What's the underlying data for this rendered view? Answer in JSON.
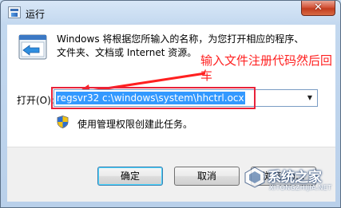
{
  "window": {
    "title": "运行",
    "close_glyph": "✕"
  },
  "description": {
    "line1": "Windows 将根据您所输入的名称，为您打开相应的程序、",
    "line2": "文件夹、文档或 Internet 资源。"
  },
  "annotation": {
    "text": "输入文件注册代码然后回车",
    "color": "#ff2020"
  },
  "open_field": {
    "label": "打开(O):",
    "value": "regsvr32 c:\\windows\\system\\hhctrl.ocx",
    "dropdown_glyph": "▼"
  },
  "admin_note": {
    "text": "使用管理权限创建此任务。"
  },
  "buttons": {
    "ok": "确定",
    "cancel": "取消",
    "browse": "浏览(B)..."
  },
  "watermark": {
    "title": "系统之家",
    "url": "XITONGZHIJIA.NET"
  },
  "icons": {
    "app": "run-dialog-icon",
    "run": "run-program-icon",
    "shield": "uac-shield-icon",
    "arrow": "annotation-arrow",
    "watermark_logo": "xitongzhijia-logo"
  },
  "colors": {
    "accent_selection": "#3399ff",
    "annotation_box": "#e8233a",
    "close_button": "#c23d1f"
  }
}
